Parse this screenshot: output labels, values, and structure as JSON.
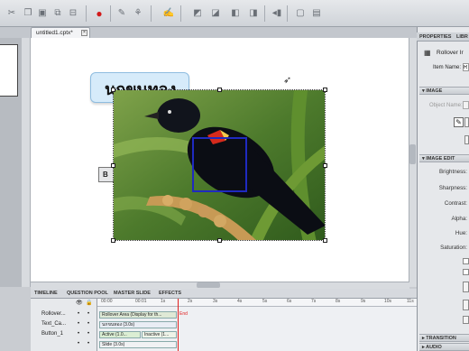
{
  "toolbar": {
    "icons": [
      "scissors-icon",
      "copy-icon",
      "paste-icon",
      "duplicate-icon",
      "delete-icon",
      "record-icon",
      "insert-slide-icon",
      "animation-icon",
      "text-caption-icon",
      "rollover-icon",
      "highlight-icon",
      "click-box-icon",
      "button-icon",
      "audio-icon",
      "zoom-icon",
      "image-icon"
    ]
  },
  "document": {
    "tab_label": "untitled1.cptx*",
    "close": "×"
  },
  "stage": {
    "caption_text": "นกขนทอง",
    "button_label": "B"
  },
  "timeline": {
    "tabs": [
      "TIMELINE",
      "QUESTION POOL",
      "MASTER SLIDE",
      "EFFECTS"
    ],
    "ticks": [
      "00:00",
      "00:01",
      "1s",
      "2s",
      "3s",
      "4s",
      "5s",
      "6s",
      "7s",
      "8s",
      "9s",
      "10s",
      "11s"
    ],
    "rows": [
      {
        "name": "Rollover...",
        "bar": "Rollover Area (Display for th...",
        "end_label": "End"
      },
      {
        "name": "Text_Ca...",
        "bar": "นกขนทอง (3.0s)"
      },
      {
        "name": "Button_1",
        "bar": "Active (1.0...",
        "bar2": "Inactive (1..."
      },
      {
        "name": "",
        "bar": "Slide (3.0s)"
      }
    ]
  },
  "properties": {
    "tabs": [
      "PROPERTIES",
      "LIBR"
    ],
    "title": "Rollover Ir",
    "item_name_label": "Item Name:",
    "item_name_value": "R",
    "sections": {
      "image": "IMAGE",
      "image_edit": "IMAGE EDIT",
      "transition": "TRANSITION",
      "audio": "AUDIO"
    },
    "object_name_label": "Object Name:",
    "edit_labels": [
      "Brightness:",
      "Sharpness:",
      "Contrast:",
      "Alpha:",
      "Hue:",
      "Saturation:"
    ]
  },
  "colors": {
    "rollover_border": "#1f2ac0",
    "playhead": "#e02020",
    "caption_fill": "#d6ebfa"
  }
}
